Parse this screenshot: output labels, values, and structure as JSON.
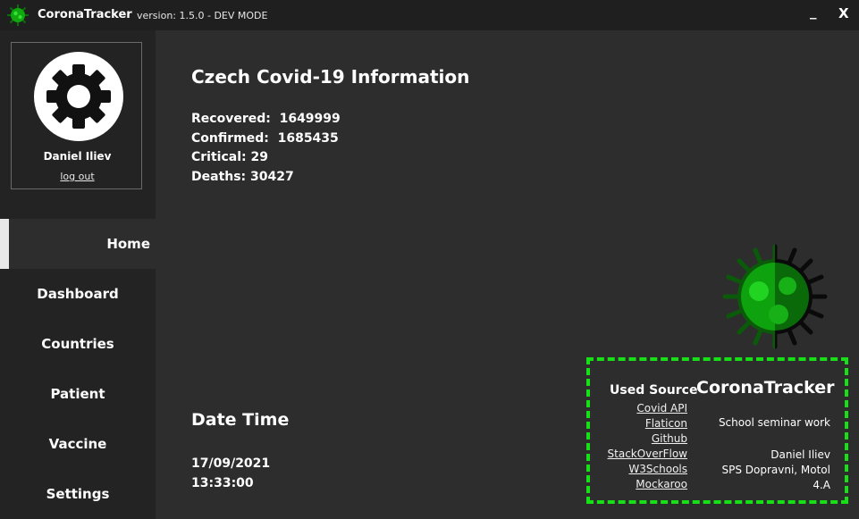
{
  "titlebar": {
    "app_name": "CoronaTracker",
    "version": "version: 1.5.0 - DEV MODE",
    "minimize_label": "_",
    "close_label": "X"
  },
  "profile": {
    "avatar_icon": "gear-icon",
    "name": "Daniel Iliev",
    "logout": "log out"
  },
  "nav": {
    "items": [
      {
        "label": "Home",
        "active": true
      },
      {
        "label": "Dashboard"
      },
      {
        "label": "Countries"
      },
      {
        "label": "Patient"
      },
      {
        "label": "Vaccine"
      },
      {
        "label": "Settings"
      }
    ]
  },
  "main": {
    "title": "Czech Covid-19 Information",
    "stats": {
      "recovered": "Recovered:  1649999",
      "confirmed": "Confirmed:  1685435",
      "critical": "Critical: 29",
      "deaths": "Deaths: 30427"
    },
    "datetime": {
      "title": "Date Time",
      "date": "17/09/2021",
      "time": "13:33:00"
    }
  },
  "info_box": {
    "sources_title": "Used Source",
    "sources": [
      "Covid API",
      "Flaticon",
      "Github",
      "StackOverFlow",
      "W3Schools",
      "Mockaroo"
    ],
    "brand": "CoronaTracker",
    "subtitle": "School seminar work",
    "author": "Daniel Iliev",
    "school": "SPS Dopravni, Motol",
    "class": "4.A"
  },
  "colors": {
    "accent_green": "#16e016",
    "background": "#2d2d2d",
    "sidebar": "#232323",
    "titlebar": "#1f1f1f"
  }
}
